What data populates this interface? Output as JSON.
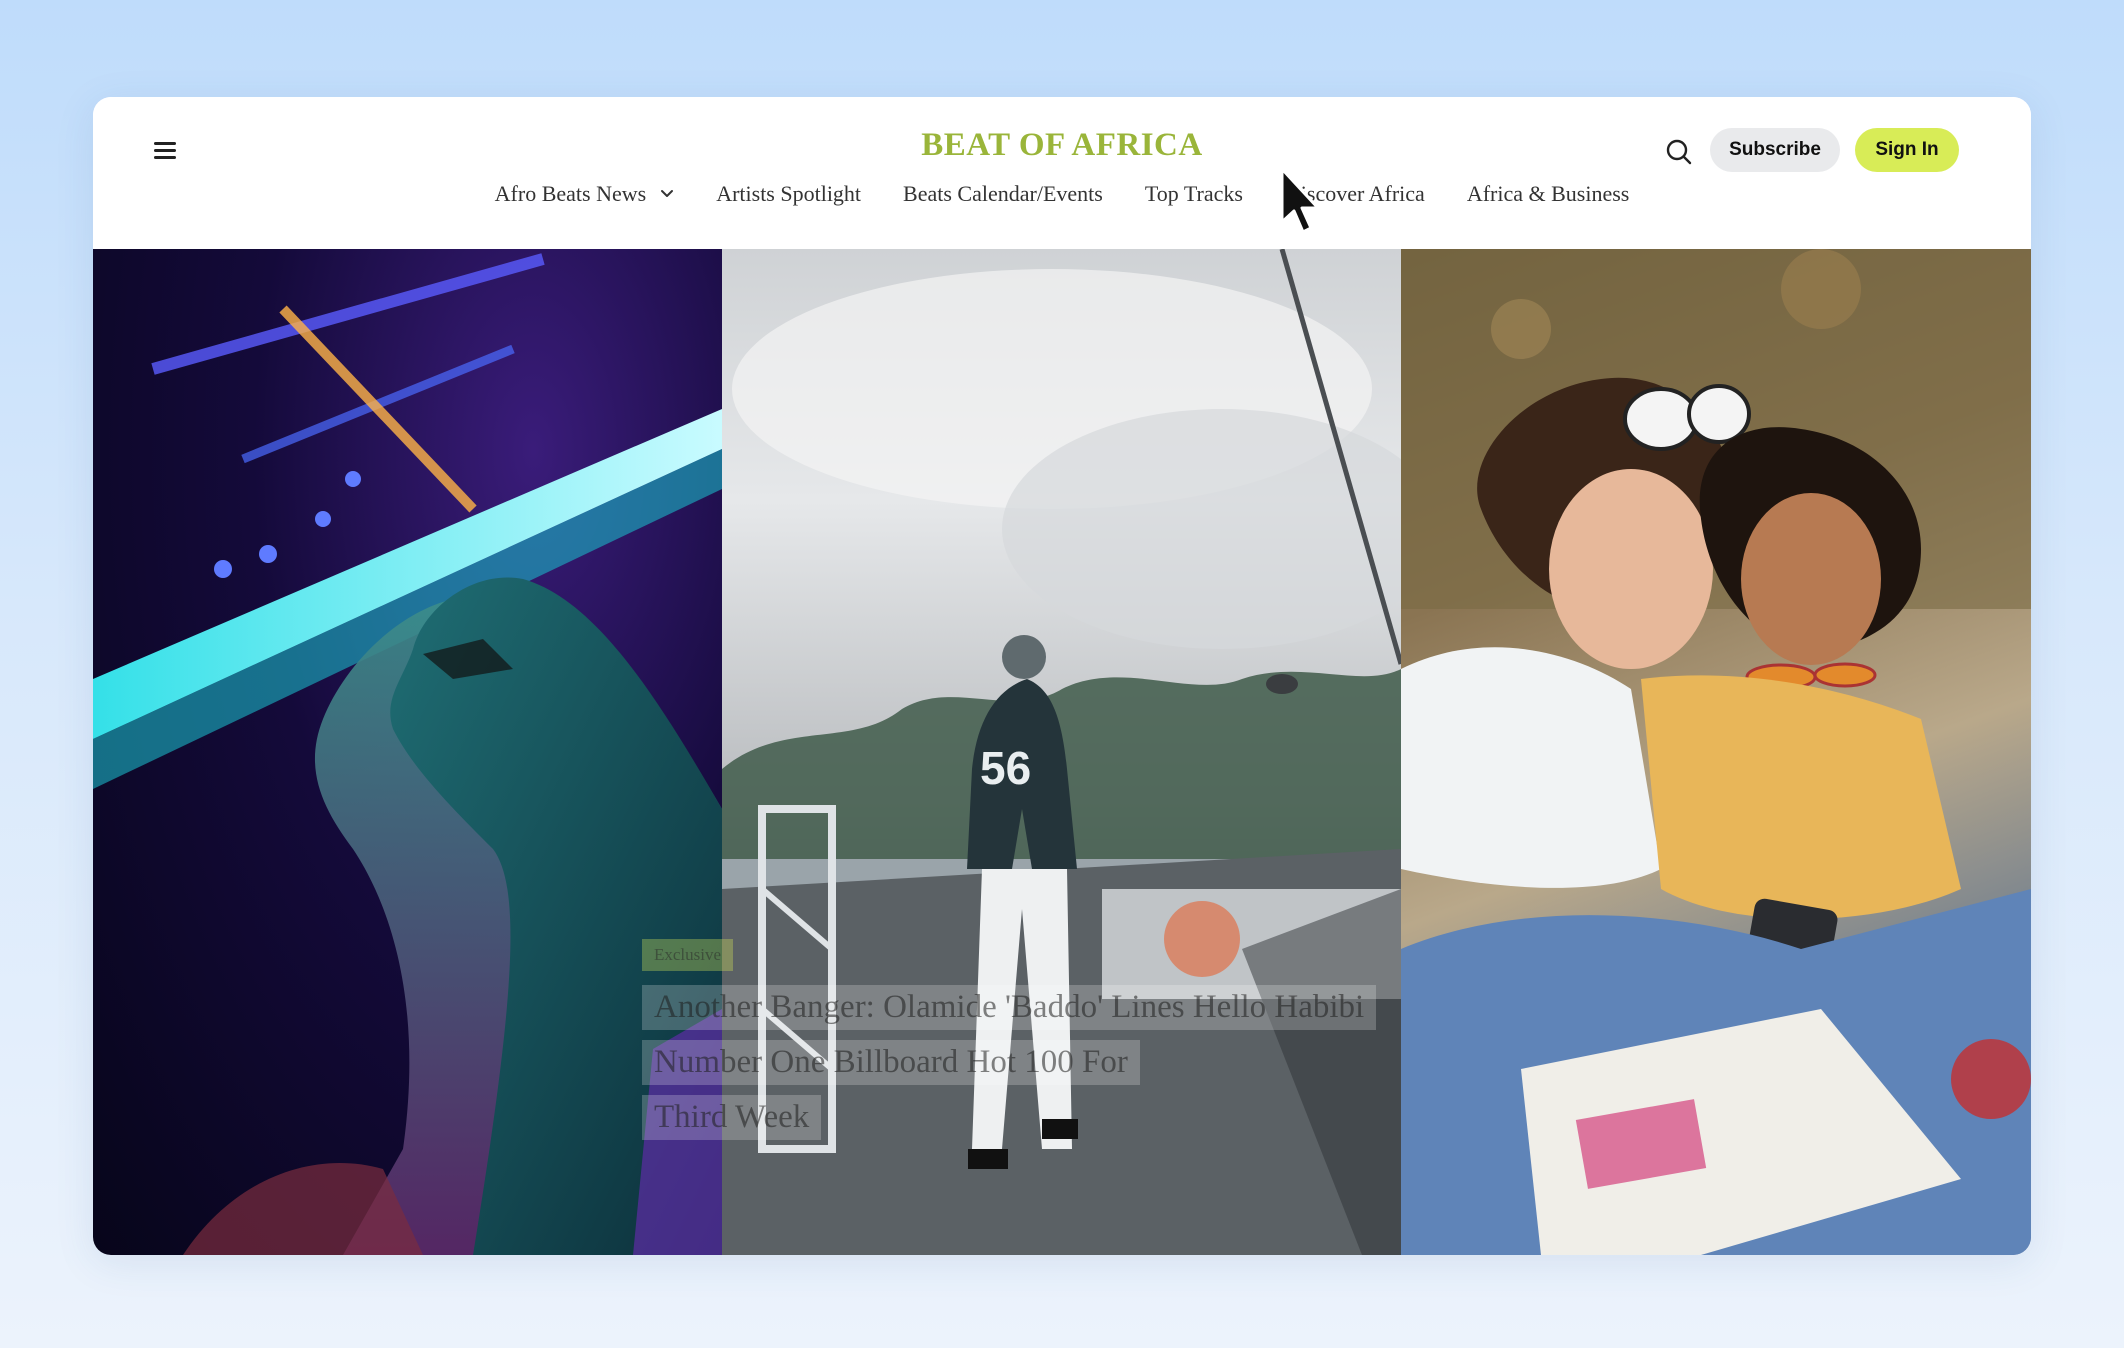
{
  "site": {
    "logo": "BEAT OF AFRICA",
    "nav": [
      {
        "label": "Afro Beats News",
        "has_dropdown": true
      },
      {
        "label": "Artists Spotlight"
      },
      {
        "label": "Beats Calendar/Events"
      },
      {
        "label": "Top Tracks"
      },
      {
        "label": "Discover Africa"
      },
      {
        "label": "Africa & Business"
      }
    ],
    "actions": {
      "subscribe": "Subscribe",
      "sign_in": "Sign In"
    },
    "icons": {
      "menu": "hamburger-menu-icon",
      "search": "search-icon",
      "dropdown": "chevron-down-icon"
    }
  },
  "hero": {
    "badge": "Exclusive",
    "headline_lines": [
      "Another Banger: Olamide 'Baddo' Lines Hello Habibi",
      "Number One Billboard Hot 100 For",
      "Third Week"
    ],
    "images": [
      "neon-portrait",
      "concert-performer",
      "friends-on-phone"
    ]
  },
  "colors": {
    "accent": "#d8ec57",
    "logo": "#9ab53a",
    "subscribe_bg": "#e9eaec",
    "page_bg": "#cfe3fb"
  }
}
